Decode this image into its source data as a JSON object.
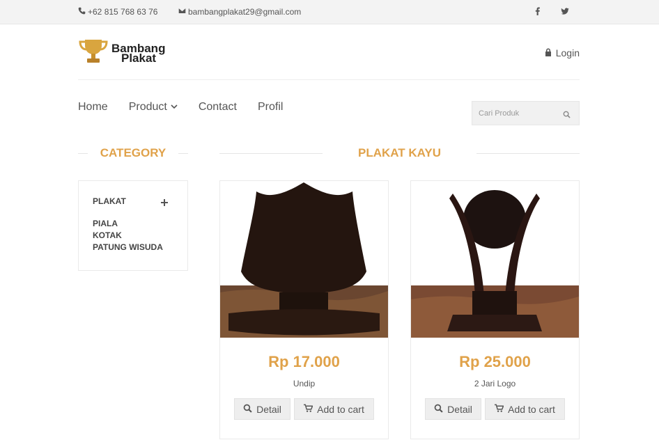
{
  "topbar": {
    "phone": "+62 815 768 63 76",
    "email": "bambangplakat29@gmail.com",
    "social": [
      "facebook-icon",
      "twitter-icon"
    ]
  },
  "header": {
    "logo_line1": "Bambang",
    "logo_line2": "Plakat",
    "login": "Login"
  },
  "nav": {
    "home": "Home",
    "product": "Product",
    "contact": "Contact",
    "profil": "Profil"
  },
  "search": {
    "placeholder": "Cari Produk"
  },
  "sidebar": {
    "title": "CATEGORY",
    "items": [
      "PLAKAT",
      "PIALA",
      "KOTAK",
      "PATUNG WISUDA"
    ]
  },
  "main": {
    "title": "PLAKAT KAYU",
    "products": [
      {
        "price": "Rp 17.000",
        "name": "Undip",
        "detail": "Detail",
        "cart": "Add to cart"
      },
      {
        "price": "Rp 25.000",
        "name": "2 Jari Logo",
        "detail": "Detail",
        "cart": "Add to cart"
      }
    ]
  },
  "colors": {
    "accent": "#e0a24a",
    "topbar": "#f3f3f3"
  }
}
